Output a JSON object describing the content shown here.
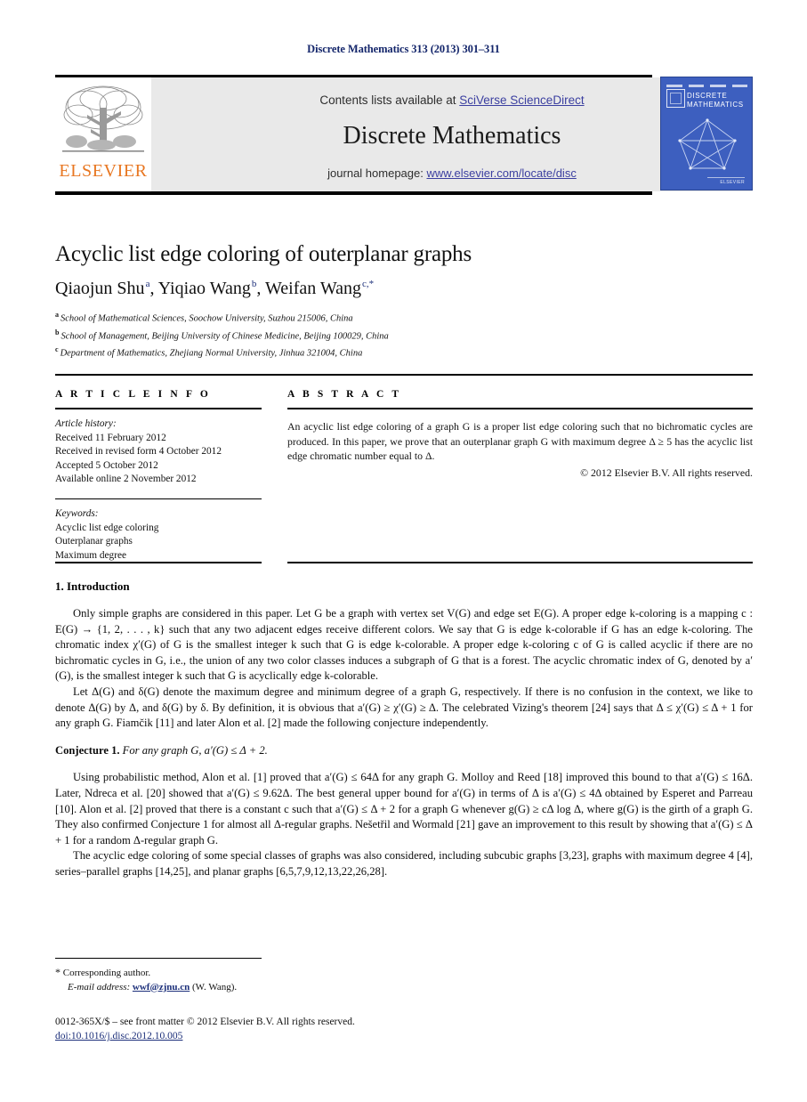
{
  "running_head": "Discrete Mathematics 313 (2013) 301–311",
  "masthead": {
    "contents_prefix": "Contents lists available at ",
    "contents_link": "SciVerse ScienceDirect",
    "journal_title": "Discrete Mathematics",
    "homepage_prefix": "journal homepage: ",
    "homepage_link": "www.elsevier.com/locate/disc",
    "publisher_wordmark": "ELSEVIER",
    "cover": {
      "line1": "DISCRETE",
      "line2": "MATHEMATICS",
      "footer_text": "ELSEVIER"
    }
  },
  "article": {
    "title": "Acyclic list edge coloring of outerplanar graphs",
    "authors": [
      {
        "name": "Qiaojun Shu",
        "marks": "a",
        "sep": ", "
      },
      {
        "name": "Yiqiao Wang",
        "marks": "b",
        "sep": ", "
      },
      {
        "name": "Weifan Wang",
        "marks": "c,*",
        "sep": ""
      }
    ],
    "affiliations": [
      {
        "mark": "a",
        "text": "School of Mathematical Sciences, Soochow University, Suzhou 215006, China"
      },
      {
        "mark": "b",
        "text": "School of Management, Beijing University of Chinese Medicine, Beijing 100029, China"
      },
      {
        "mark": "c",
        "text": "Department of Mathematics, Zhejiang Normal University, Jinhua 321004, China"
      }
    ]
  },
  "article_info": {
    "heading": "A R T I C L E   I N F O",
    "history_label": "Article history:",
    "history": [
      "Received 11 February 2012",
      "Received in revised form 4 October 2012",
      "Accepted 5 October 2012",
      "Available online 2 November 2012"
    ],
    "keywords_label": "Keywords:",
    "keywords": [
      "Acyclic list edge coloring",
      "Outerplanar graphs",
      "Maximum degree"
    ]
  },
  "abstract": {
    "heading": "A B S T R A C T",
    "text": "An acyclic list edge coloring of a graph G is a proper list edge coloring such that no bichromatic cycles are produced. In this paper, we prove that an outerplanar graph G with maximum degree Δ ≥ 5 has the acyclic list edge chromatic number equal to Δ.",
    "copyright": "© 2012 Elsevier B.V. All rights reserved."
  },
  "body": {
    "section_number_title": "1. Introduction",
    "para1": "Only simple graphs are considered in this paper. Let G be a graph with vertex set V(G) and edge set E(G). A proper edge k-coloring is a mapping c : E(G) → {1, 2, . . . , k} such that any two adjacent edges receive different colors. We say that G is edge k-colorable if G has an edge k-coloring. The chromatic index χ′(G) of G is the smallest integer k such that G is edge k-colorable. A proper edge k-coloring c of G is called acyclic if there are no bichromatic cycles in G, i.e., the union of any two color classes induces a subgraph of G that is a forest. The acyclic chromatic index of G, denoted by a′(G), is the smallest integer k such that G is acyclically edge k-colorable.",
    "para2": "Let Δ(G) and δ(G) denote the maximum degree and minimum degree of a graph G, respectively. If there is no confusion in the context, we like to denote Δ(G) by Δ, and δ(G) by δ. By definition, it is obvious that a′(G) ≥ χ′(G) ≥ Δ. The celebrated Vizing's theorem [24] says that Δ ≤ χ′(G) ≤ Δ + 1 for any graph G. Fiamčik [11] and later Alon et al. [2] made the following conjecture independently.",
    "conjecture_label": "Conjecture 1.",
    "conjecture_text": "For any graph G, a′(G) ≤ Δ + 2.",
    "para3": "Using probabilistic method, Alon et al. [1] proved that a′(G) ≤ 64Δ for any graph G. Molloy and Reed [18] improved this bound to that a′(G) ≤ 16Δ. Later, Ndreca et al. [20] showed that a′(G) ≤ 9.62Δ. The best general upper bound for a′(G) in terms of Δ is a′(G) ≤ 4Δ obtained by Esperet and Parreau [10]. Alon et al. [2] proved that there is a constant c such that a′(G) ≤ Δ + 2 for a graph G whenever g(G) ≥ cΔ log Δ, where g(G) is the girth of a graph G. They also confirmed Conjecture 1 for almost all Δ-regular graphs. Nešetřil and Wormald [21] gave an improvement to this result by showing that a′(G) ≤ Δ + 1 for a random Δ-regular graph G.",
    "para4": "The acyclic edge coloring of some special classes of graphs was also considered, including subcubic graphs [3,23], graphs with maximum degree 4 [4], series–parallel graphs [14,25], and planar graphs [6,5,7,9,12,13,22,26,28]."
  },
  "footer": {
    "corresponding_marker": "*",
    "corresponding_text": "Corresponding author.",
    "email_label": "E-mail address:",
    "email": "wwf@zjnu.cn",
    "email_suffix": "(W. Wang).",
    "colophon_line": "0012-365X/$ – see front matter © 2012 Elsevier B.V. All rights reserved.",
    "doi": "doi:10.1016/j.disc.2012.10.005"
  },
  "colors": {
    "link_blue": "#3b3fa0",
    "ref_blue": "#1c2f7a",
    "elsevier_orange": "#e87722",
    "cover_blue": "#3d5fbf",
    "banner_gray": "#e9e9e9"
  }
}
